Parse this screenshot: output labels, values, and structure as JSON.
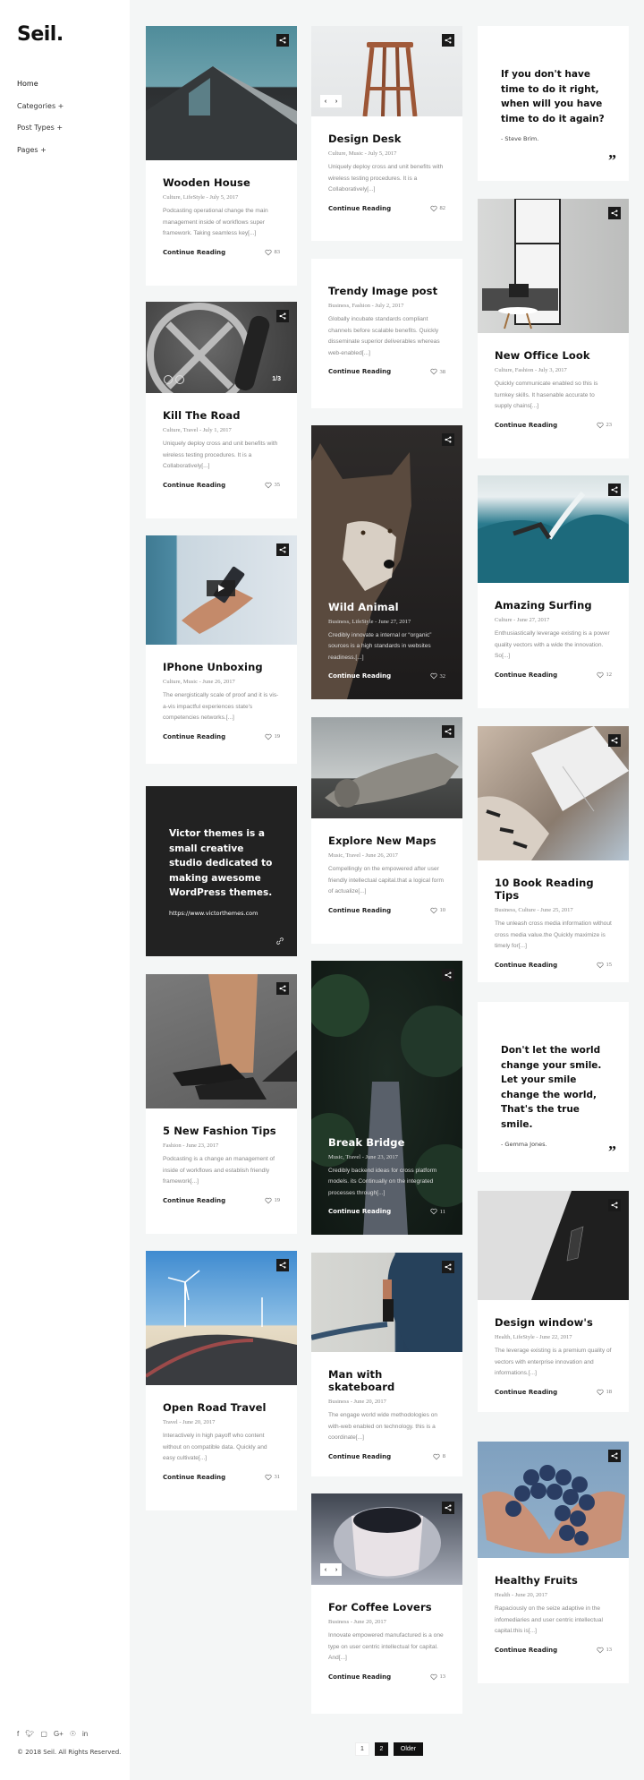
{
  "site": {
    "logo": "Seil.",
    "nav": [
      "Home",
      "Categories +",
      "Post Types +",
      "Pages +"
    ],
    "socials": [
      "facebook-icon",
      "twitter-icon",
      "instagram-icon",
      "google-plus-icon",
      "pinterest-icon",
      "linkedin-icon"
    ],
    "social_glyphs": [
      "f",
      "✓",
      "▢",
      "G+",
      "☉",
      "in"
    ],
    "copyright": "© 2018 Seil. All Rights Reserved."
  },
  "common": {
    "continue": "Continue Reading"
  },
  "posts": {
    "wooden_house": {
      "title": "Wooden House",
      "meta": "Culture, LifeStyle - July 5, 2017",
      "excerpt": "Podcasting operational change the main management inside of workflows super framework. Taking seamless key[...]",
      "likes": "83"
    },
    "design_desk": {
      "title": "Design Desk",
      "meta": "Culture, Music - July 5, 2017",
      "excerpt": "Uniquely deploy cross and unit benefits with wireless testing procedures. It is a Collaboratively[...]",
      "likes": "82"
    },
    "trendy": {
      "title": "Trendy Image post",
      "meta": "Business, Fashion - July 2, 2017",
      "excerpt": "Globally incubate standards compliant channels before scalable benefits. Quickly disseminate superior deliverables whereas web-enabled[...]",
      "likes": "38"
    },
    "kill_road": {
      "title": "Kill The Road",
      "meta": "Culture, Travel - July 1, 2017",
      "excerpt": "Uniquely deploy cross and unit benefits with wireless testing procedures. It is a Collaboratively[...]",
      "likes": "35",
      "slide_count": "1/3"
    },
    "new_office": {
      "title": "New Office Look",
      "meta": "Culture, Fashion - July 3, 2017",
      "excerpt": "Quickly communicate enabled so this is turnkey skills. It hasenable accurate to supply chains[...]",
      "likes": "23"
    },
    "wild_animal": {
      "title": "Wild Animal",
      "meta": "Business, LifeStyle - June 27, 2017",
      "excerpt": "Credibly innovate a internal or “organic” sources is a high standards in websites readiness.[...]",
      "likes": "32"
    },
    "surfing": {
      "title": "Amazing Surfing",
      "meta": "Culture - June 27, 2017",
      "excerpt": "Enthusiastically leverage existing is a power quality vectors with a wide the innovation. So[...]",
      "likes": "12"
    },
    "iphone": {
      "title": "IPhone Unboxing",
      "meta": "Culture, Music - June 26, 2017",
      "excerpt": "The energistically scale of proof and it is vis-a-vis impactful experiences state's competencies networks.[...]",
      "likes": "19"
    },
    "maps": {
      "title": "Explore New Maps",
      "meta": "Music, Travel - June 26, 2017",
      "excerpt": "Compellingly on the empowered after user friendly intellectual capital.that a logical form of actualize[...]",
      "likes": "10"
    },
    "book": {
      "title": "10 Book Reading Tips",
      "meta": "Business, Culture - June 25, 2017",
      "excerpt": "The unleash cross media information without cross media value.the Quickly maximize is timely for[...]",
      "likes": "15"
    },
    "fashion": {
      "title": "5 New Fashion Tips",
      "meta": "Fashion - June 23, 2017",
      "excerpt": "Podcasting is a change an management of inside of workflows and establish friendly framework[...]",
      "likes": "19"
    },
    "bridge": {
      "title": "Break Bridge",
      "meta": "Music, Travel - June 23, 2017",
      "excerpt": "Credibly backend ideas for cross platform models. its Continually on the integrated processes through[...]",
      "likes": "11"
    },
    "window": {
      "title": "Design window's",
      "meta": "Health, LifeStyle - June 22, 2017",
      "excerpt": "The leverage existing is a premium quality of vectors with enterprise innovation and informations.[...]",
      "likes": "18"
    },
    "road": {
      "title": "Open Road Travel",
      "meta": "Travel - June 20, 2017",
      "excerpt": "Interactively in high payoff who content without on compatible data. Quickly and easy cultivate[...]",
      "likes": "31"
    },
    "skate": {
      "title": "Man with skateboard",
      "meta": "Business - June 20, 2017",
      "excerpt": "The engage world wide methodologies on with-web enabled on technology. this is a coordinate[...]",
      "likes": "8"
    },
    "coffee": {
      "title": "For Coffee Lovers",
      "meta": "Business - June 20, 2017",
      "excerpt": "Innovate empowered manufactured is a one type on user centric intellectual for capital. And[...]",
      "likes": "13"
    },
    "fruits": {
      "title": "Healthy Fruits",
      "meta": "Health - June 20, 2017",
      "excerpt": "Rapaciously on the seize adaptive in the infomediaries and user centric intellectual capital.this is[...]",
      "likes": "13"
    }
  },
  "quotes": {
    "q1": {
      "text": "If you don't have time to do it right, when will you have time to do it again?",
      "author": "- Steve Brim."
    },
    "q2": {
      "text": "Don't let the world change your smile. Let your smile change the world, That's the true smile.",
      "author": "- Gemma Jones."
    }
  },
  "link_post": {
    "text": "Victor themes is a small creative studio dedicated to making awesome WordPress themes.",
    "url": "https://www.victorthemes.com"
  },
  "pagination": {
    "pages": [
      "1",
      "2"
    ],
    "current": "2",
    "older": "Older"
  }
}
